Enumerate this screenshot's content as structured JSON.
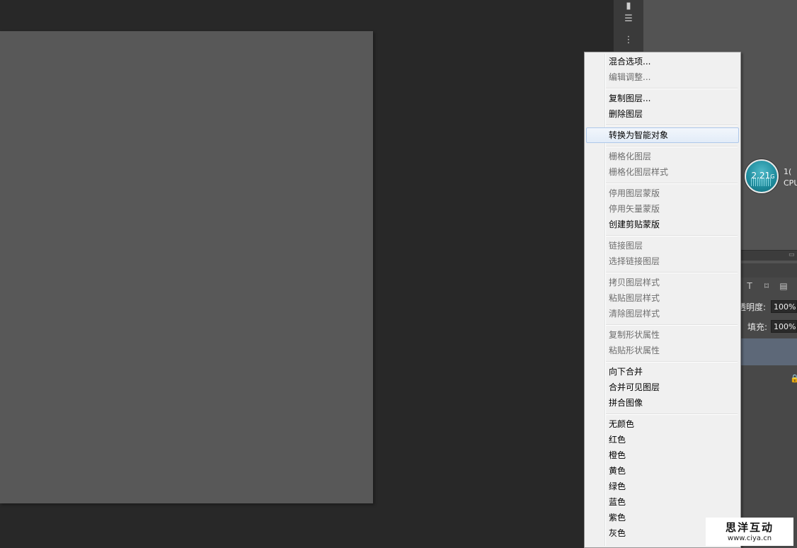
{
  "context_menu": {
    "items": [
      {
        "label": "混合选项...",
        "enabled": true
      },
      {
        "label": "编辑调整...",
        "enabled": false
      },
      {
        "label": "复制图层...",
        "enabled": true
      },
      {
        "label": "删除图层",
        "enabled": true
      },
      {
        "label": "转换为智能对象",
        "enabled": true,
        "highlighted": true
      },
      {
        "label": "栅格化图层",
        "enabled": false
      },
      {
        "label": "栅格化图层样式",
        "enabled": false
      },
      {
        "label": "停用图层蒙版",
        "enabled": false
      },
      {
        "label": "停用矢量蒙版",
        "enabled": false
      },
      {
        "label": "创建剪贴蒙版",
        "enabled": true
      },
      {
        "label": "链接图层",
        "enabled": false
      },
      {
        "label": "选择链接图层",
        "enabled": false
      },
      {
        "label": "拷贝图层样式",
        "enabled": false
      },
      {
        "label": "粘贴图层样式",
        "enabled": false
      },
      {
        "label": "清除图层样式",
        "enabled": false
      },
      {
        "label": "复制形状属性",
        "enabled": false
      },
      {
        "label": "粘贴形状属性",
        "enabled": false
      },
      {
        "label": "向下合并",
        "enabled": true
      },
      {
        "label": "合并可见图层",
        "enabled": true
      },
      {
        "label": "拼合图像",
        "enabled": true
      },
      {
        "label": "无颜色",
        "enabled": true
      },
      {
        "label": "红色",
        "enabled": true
      },
      {
        "label": "橙色",
        "enabled": true
      },
      {
        "label": "黄色",
        "enabled": true
      },
      {
        "label": "绿色",
        "enabled": true
      },
      {
        "label": "蓝色",
        "enabled": true
      },
      {
        "label": "紫色",
        "enabled": true
      },
      {
        "label": "灰色",
        "enabled": true
      }
    ]
  },
  "layers_panel": {
    "opacity_label": "透明度:",
    "opacity_value": "100%",
    "fill_label": "填充:",
    "fill_value": "100%"
  },
  "cpu_widget": {
    "value": "2.21",
    "unit": "G",
    "side_top": "1(",
    "side_bottom": "CPU"
  },
  "watermark": {
    "title": "思洋互动",
    "url": "www.ciya.cn"
  },
  "colors": {
    "workspace": "#282828",
    "canvas": "#585858",
    "panel": "#535353",
    "menu_bg": "#f0f0f0",
    "highlight_border": "#aec8ea"
  }
}
